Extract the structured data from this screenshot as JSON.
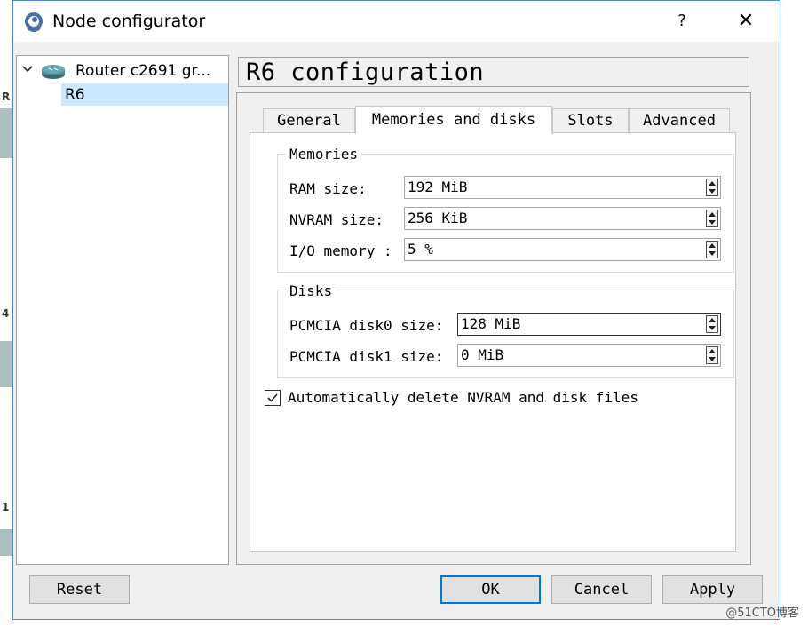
{
  "window": {
    "title": "Node configurator",
    "help_label": "?",
    "close_label": "✕"
  },
  "tree": {
    "root_label": "Router c2691 gr...",
    "child_label": "R6",
    "chevron": "∨"
  },
  "page_header": "R6 configuration",
  "tabs": [
    {
      "label": "General"
    },
    {
      "label": "Memories and disks"
    },
    {
      "label": "Slots"
    },
    {
      "label": "Advanced"
    }
  ],
  "memories": {
    "title": "Memories",
    "ram_label": "RAM size:",
    "ram_value": "192 MiB",
    "nvram_label": "NVRAM size:",
    "nvram_value": "256 KiB",
    "io_label": "I/O memory :",
    "io_value": "5 %"
  },
  "disks": {
    "title": "Disks",
    "disk0_label": "PCMCIA disk0 size:",
    "disk0_value": "128 MiB",
    "disk1_label": "PCMCIA disk1 size:",
    "disk1_value": "0 MiB"
  },
  "auto_delete": {
    "label": "Automatically delete NVRAM and disk files",
    "checked": true
  },
  "buttons": {
    "reset": "Reset",
    "ok": "OK",
    "cancel": "Cancel",
    "apply": "Apply"
  },
  "background": {
    "chars": [
      "R",
      "4",
      "1"
    ],
    "watermark": "@51CTO博客"
  },
  "colors": {
    "accent": "#0078d7",
    "selection": "#cce8ff",
    "window_border": "#4a8ad4"
  }
}
